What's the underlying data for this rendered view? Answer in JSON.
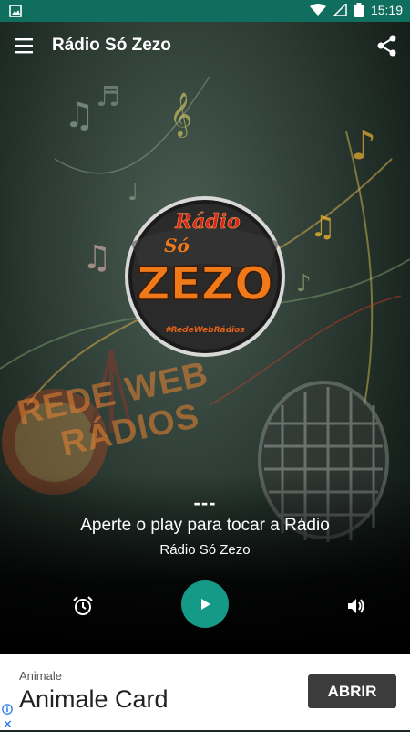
{
  "status_bar": {
    "time": "15:19",
    "battery_bolt": "⚡",
    "icons": [
      "image-icon",
      "wifi-icon",
      "signal-icon",
      "battery-icon"
    ]
  },
  "app_bar": {
    "title": "Rádio Só Zezo",
    "icons": [
      "menu-icon",
      "share-icon"
    ]
  },
  "logo": {
    "line1": "Rádio",
    "line2": "Só",
    "line3": "ZEZO",
    "tag": "#RedeWebRádios"
  },
  "watermark": {
    "line1": "REDE WEB",
    "line2": "RÁDIOS"
  },
  "player": {
    "track": "---",
    "message": "Aperte o play para tocar a Rádio",
    "station": "Rádio Só Zezo",
    "icons": [
      "alarm-icon",
      "play-icon",
      "volume-icon"
    ]
  },
  "ad": {
    "advertiser": "Animale",
    "headline": "Animale Card",
    "cta": "ABRIR",
    "info_glyph": "i",
    "close_glyph": "✕"
  },
  "colors": {
    "status_bar": "#0f6e5e",
    "accent": "#159a88",
    "logo_orange": "#f07a1a",
    "logo_red": "#d9261c"
  }
}
